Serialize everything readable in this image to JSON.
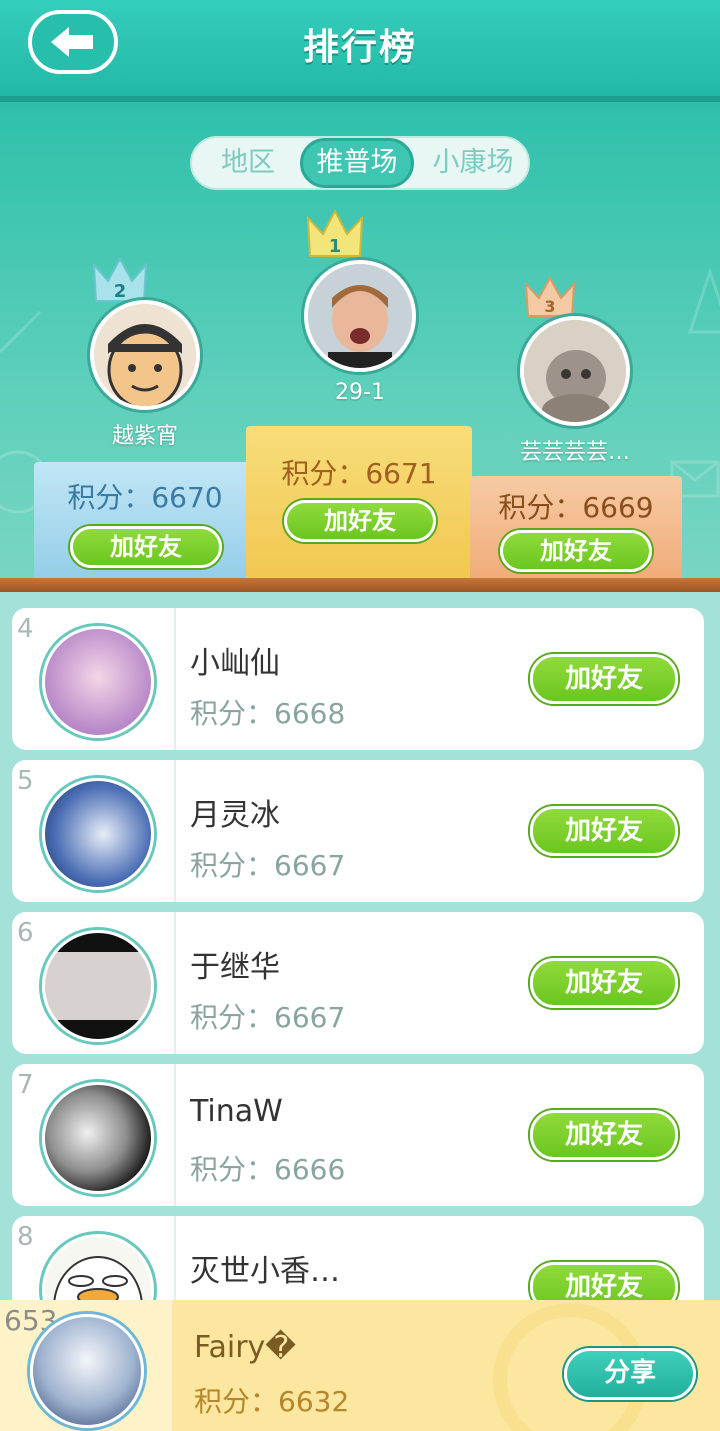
{
  "header": {
    "title": "排行榜",
    "back_icon": "back-arrow-icon"
  },
  "tabs": {
    "items": [
      "地区",
      "推普场",
      "小康场"
    ],
    "active": "推普场"
  },
  "podium": [
    {
      "rank": "1",
      "name": "29-1",
      "score_text": "积分：6671",
      "button": "加好友"
    },
    {
      "rank": "2",
      "name": "越紫宵",
      "score_text": "积分：6670",
      "button": "加好友"
    },
    {
      "rank": "3",
      "name": "芸芸芸芸…",
      "score_text": "积分：6669",
      "button": "加好友"
    }
  ],
  "list": [
    {
      "rank": "4",
      "name": "小屾仙",
      "score_text": "积分：6668",
      "button": "加好友"
    },
    {
      "rank": "5",
      "name": "月灵冰",
      "score_text": "积分：6667",
      "button": "加好友"
    },
    {
      "rank": "6",
      "name": "于继华",
      "score_text": "积分：6667",
      "button": "加好友"
    },
    {
      "rank": "7",
      "name": "TinaW",
      "score_text": "积分：6666",
      "button": "加好友"
    },
    {
      "rank": "8",
      "name": "灭世小香…",
      "score_text": "",
      "button": "加好友"
    }
  ],
  "me": {
    "rank": "653",
    "name": "Fairy�",
    "score_text": "积分：6632",
    "share": "分享"
  },
  "colors": {
    "header": "#22b9a6",
    "add_button": "#7ace2a",
    "first_block": "#f6d468",
    "second_block": "#a6d8ee",
    "third_block": "#f4b98c",
    "my_bar": "#fbe7a0"
  }
}
